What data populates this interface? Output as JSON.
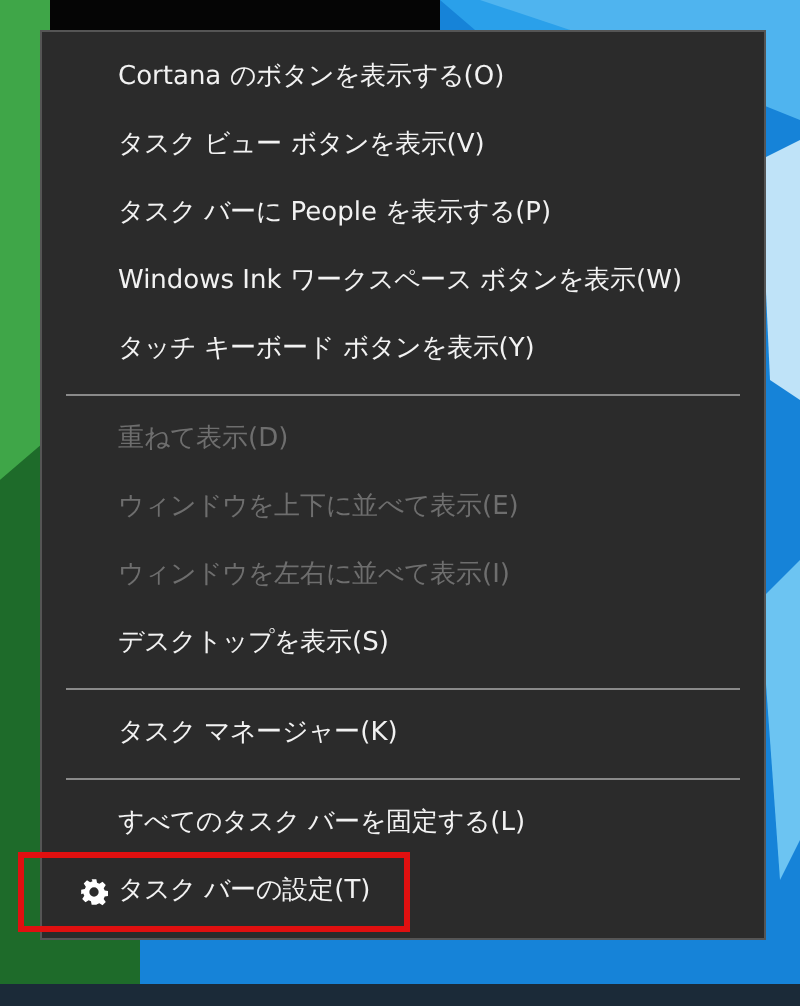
{
  "context_menu": {
    "groups": [
      {
        "items": [
          {
            "label": "Cortana のボタンを表示する(O)",
            "kind": "plain",
            "disabled": false,
            "highlighted": false
          },
          {
            "label": "タスク ビュー ボタンを表示(V)",
            "kind": "plain",
            "disabled": false,
            "highlighted": false
          },
          {
            "label": "タスク バーに People を表示する(P)",
            "kind": "plain",
            "disabled": false,
            "highlighted": false
          },
          {
            "label": "Windows Ink ワークスペース ボタンを表示(W)",
            "kind": "plain",
            "disabled": false,
            "highlighted": false
          },
          {
            "label": "タッチ キーボード ボタンを表示(Y)",
            "kind": "plain",
            "disabled": false,
            "highlighted": false
          }
        ]
      },
      {
        "items": [
          {
            "label": "重ねて表示(D)",
            "kind": "plain",
            "disabled": true,
            "highlighted": false
          },
          {
            "label": "ウィンドウを上下に並べて表示(E)",
            "kind": "plain",
            "disabled": true,
            "highlighted": false
          },
          {
            "label": "ウィンドウを左右に並べて表示(I)",
            "kind": "plain",
            "disabled": true,
            "highlighted": false
          },
          {
            "label": "デスクトップを表示(S)",
            "kind": "plain",
            "disabled": false,
            "highlighted": false
          }
        ]
      },
      {
        "items": [
          {
            "label": "タスク マネージャー(K)",
            "kind": "plain",
            "disabled": false,
            "highlighted": false
          }
        ]
      },
      {
        "items": [
          {
            "label": "すべてのタスク バーを固定する(L)",
            "kind": "plain",
            "disabled": false,
            "highlighted": false
          },
          {
            "label": "タスク バーの設定(T)",
            "kind": "settings",
            "disabled": false,
            "highlighted": true
          }
        ]
      }
    ]
  }
}
